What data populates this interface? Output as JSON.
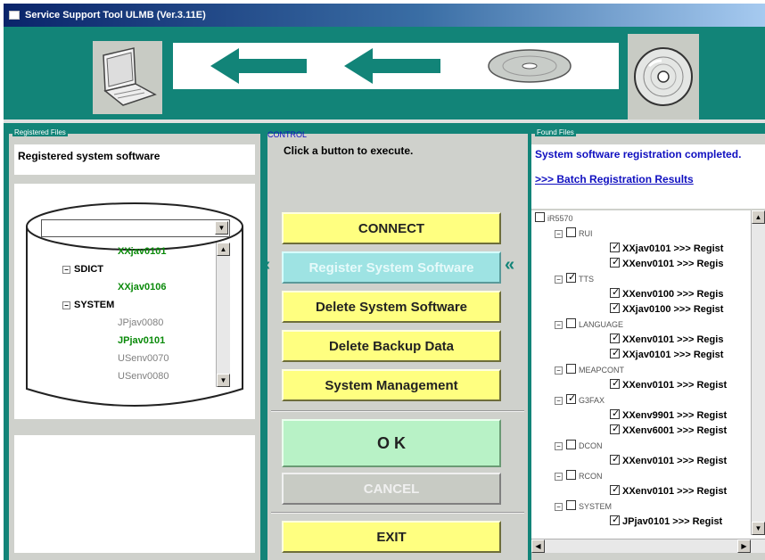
{
  "window": {
    "title": "Service Support Tool ULMB (Ver.3.11E)"
  },
  "left": {
    "group_title": "Registered Files",
    "header_text": "Registered system software",
    "tree": [
      {
        "label": "XXjav0101",
        "color": "green",
        "indent": 2
      },
      {
        "label": "SDICT",
        "color": "black",
        "bold": true,
        "indent": 1
      },
      {
        "label": "XXjav0106",
        "color": "green",
        "indent": 2
      },
      {
        "label": "SYSTEM",
        "color": "black",
        "bold": true,
        "indent": 1
      },
      {
        "label": "JPjav0080",
        "color": "gray",
        "indent": 2
      },
      {
        "label": "JPjav0101",
        "color": "green",
        "indent": 2
      },
      {
        "label": "USenv0070",
        "color": "gray",
        "indent": 2
      },
      {
        "label": "USenv0080",
        "color": "gray",
        "indent": 2
      }
    ]
  },
  "control": {
    "group_title": "CONTROL",
    "prompt": "Click a button to execute.",
    "connect": "CONNECT",
    "register": "Register System Software",
    "delete_sw": "Delete System Software",
    "delete_backup": "Delete Backup Data",
    "sys_mgmt": "System Management",
    "ok": "O K",
    "cancel": "CANCEL",
    "exit": "EXIT",
    "arrow_glyph": "«"
  },
  "right": {
    "group_title": "Found Files",
    "status": "System software registration completed.",
    "results_title": ">>> Batch Registration Results",
    "tree": [
      {
        "label": "iR5570",
        "kind": "root",
        "checked": false
      },
      {
        "label": "RUI",
        "kind": "group",
        "checked": false
      },
      {
        "label": "XXjav0101 >>> Regist",
        "kind": "leaf",
        "checked": true
      },
      {
        "label": "XXenv0101 >>> Regis",
        "kind": "leaf",
        "checked": true
      },
      {
        "label": "TTS",
        "kind": "group",
        "checked": true
      },
      {
        "label": "XXenv0100 >>> Regis",
        "kind": "leaf",
        "checked": true
      },
      {
        "label": "XXjav0100 >>> Regist",
        "kind": "leaf",
        "checked": true
      },
      {
        "label": "LANGUAGE",
        "kind": "group",
        "checked": false
      },
      {
        "label": "XXenv0101 >>> Regis",
        "kind": "leaf",
        "checked": true
      },
      {
        "label": "XXjav0101 >>> Regist",
        "kind": "leaf",
        "checked": true
      },
      {
        "label": "MEAPCONT",
        "kind": "group",
        "checked": false
      },
      {
        "label": "XXenv0101 >>> Regist",
        "kind": "leaf",
        "checked": true
      },
      {
        "label": "G3FAX",
        "kind": "group",
        "checked": true
      },
      {
        "label": "XXenv9901 >>> Regist",
        "kind": "leaf",
        "checked": true
      },
      {
        "label": "XXenv6001 >>> Regist",
        "kind": "leaf",
        "checked": true
      },
      {
        "label": "DCON",
        "kind": "group",
        "checked": false
      },
      {
        "label": "XXenv0101 >>> Regist",
        "kind": "leaf",
        "checked": true
      },
      {
        "label": "RCON",
        "kind": "group",
        "checked": false
      },
      {
        "label": "XXenv0101 >>> Regist",
        "kind": "leaf",
        "checked": true
      },
      {
        "label": "SYSTEM",
        "kind": "group",
        "checked": false
      },
      {
        "label": "JPjav0101 >>> Regist",
        "kind": "leaf",
        "checked": true
      }
    ]
  },
  "icons": {
    "laptop": "laptop-icon",
    "cd": "cd-disc-icon",
    "arrow": "left-arrow-icon"
  },
  "colors": {
    "teal": "#128478",
    "yellow": "#ffff80",
    "cyan": "#9ee3e3",
    "green_btn": "#b8f2c6",
    "tree_green": "#0a8a0a",
    "tree_gray": "#808080",
    "link_blue": "#1010c0"
  }
}
